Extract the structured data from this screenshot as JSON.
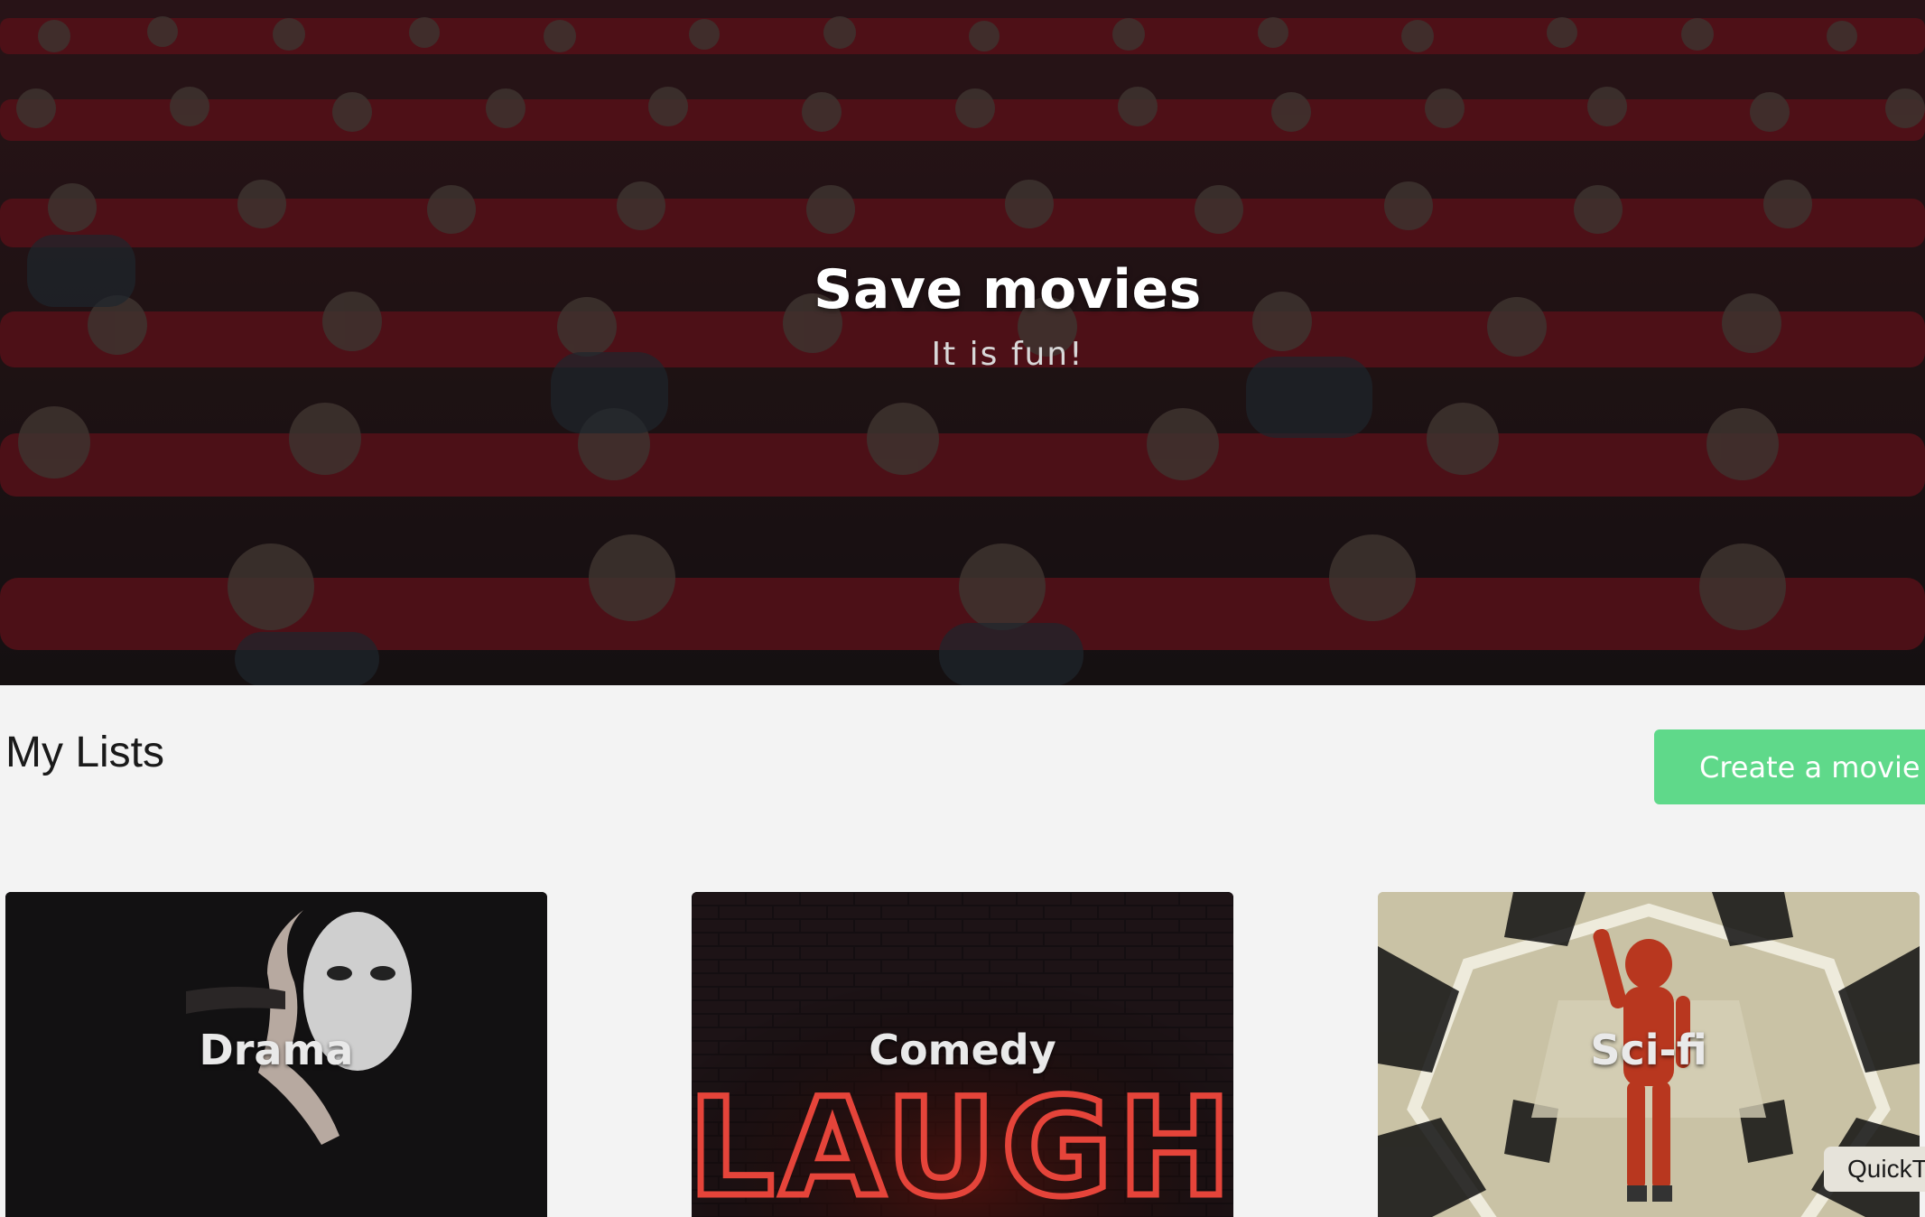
{
  "hero": {
    "title": "Save movies",
    "subtitle": "It is fun!"
  },
  "lists": {
    "title": "My Lists",
    "create_button_label": "Create a movie list"
  },
  "cards": [
    {
      "label": "Drama"
    },
    {
      "label": "Comedy"
    },
    {
      "label": "Sci-fi",
      "badge": "QuickTime"
    }
  ],
  "comedy_sign_text": "LAUGH",
  "colors": {
    "accent": "#5fd98a",
    "page_background": "#f3f3f3",
    "seat_red": "#8a1420"
  }
}
